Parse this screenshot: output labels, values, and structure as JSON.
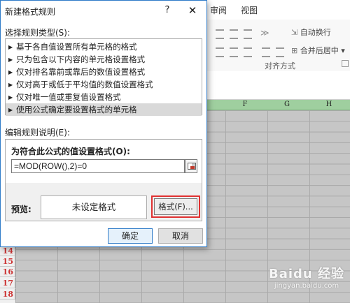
{
  "excel": {
    "tabs": [
      "审阅",
      "视图"
    ],
    "ribbon": {
      "wrap_text": "自动换行",
      "merge_center": "合并后居中",
      "group_label": "对齐方式"
    },
    "columns": [
      "F",
      "G",
      "H"
    ],
    "rows": [
      "14",
      "15",
      "16",
      "17",
      "18"
    ]
  },
  "watermark": {
    "line1": "Baidu 经验",
    "line2": "jingyan.baidu.com"
  },
  "dialog": {
    "title": "新建格式规则",
    "help": "?",
    "close": "✕",
    "rule_type_label": "选择规则类型(S):",
    "rule_types": [
      "基于各自值设置所有单元格的格式",
      "只为包含以下内容的单元格设置格式",
      "仅对排名靠前或靠后的数值设置格式",
      "仅对高于或低于平均值的数值设置格式",
      "仅对唯一值或重复值设置格式",
      "使用公式确定要设置格式的单元格"
    ],
    "selected_index": 5,
    "edit_label": "编辑规则说明(E):",
    "formula_label": "为符合此公式的值设置格式(O):",
    "formula_value": "=MOD(ROW(),2)=0",
    "preview_label": "预览:",
    "preview_text": "未设定格式",
    "format_button": "格式(F)...",
    "ok_button": "确定",
    "cancel_button": "取消"
  }
}
